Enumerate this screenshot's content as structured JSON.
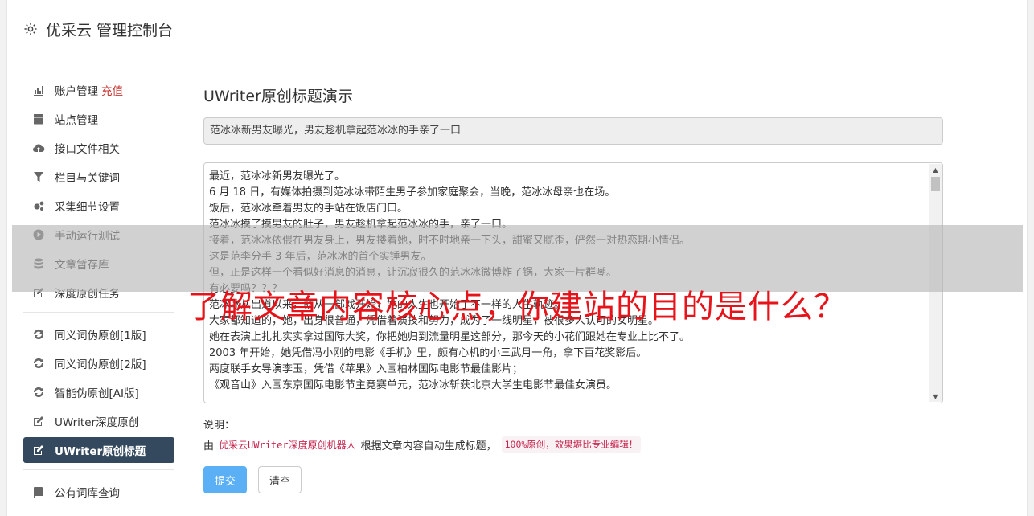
{
  "header": {
    "brand": "优采云 管理控制台"
  },
  "sidebar": {
    "group1": [
      {
        "label": "账户管理",
        "extra": "充值",
        "icon": "bar-chart-icon",
        "name": "sidebar-item-account"
      },
      {
        "label": "站点管理",
        "icon": "server-icon",
        "name": "sidebar-item-sites"
      },
      {
        "label": "接口文件相关",
        "icon": "cloud-upload-icon",
        "name": "sidebar-item-api-files"
      },
      {
        "label": "栏目与关键词",
        "icon": "filter-icon",
        "name": "sidebar-item-columns-keywords"
      },
      {
        "label": "采集细节设置",
        "icon": "gears-icon",
        "name": "sidebar-item-collect-settings"
      },
      {
        "label": "手动运行测试",
        "icon": "play-circle-icon",
        "name": "sidebar-item-manual-run"
      },
      {
        "label": "文章暂存库",
        "icon": "database-icon",
        "name": "sidebar-item-article-store"
      },
      {
        "label": "深度原创任务",
        "icon": "edit-icon",
        "name": "sidebar-item-deep-original"
      }
    ],
    "group2": [
      {
        "label": "同义词伪原创[1版]",
        "icon": "refresh-icon",
        "name": "sidebar-item-synonym-v1"
      },
      {
        "label": "同义词伪原创[2版]",
        "icon": "refresh-icon",
        "name": "sidebar-item-synonym-v2"
      },
      {
        "label": "智能伪原创[AI版]",
        "icon": "refresh-icon",
        "name": "sidebar-item-ai-rewrite"
      },
      {
        "label": "UWriter深度原创",
        "icon": "edit-icon",
        "name": "sidebar-item-uwriter-deep"
      },
      {
        "label": "UWriter原创标题",
        "icon": "edit-icon",
        "name": "sidebar-item-uwriter-title",
        "active": true
      }
    ],
    "group3": [
      {
        "label": "公有词库查询",
        "icon": "book-icon",
        "name": "sidebar-item-public-lexicon"
      }
    ]
  },
  "main": {
    "title": "UWriter原创标题演示",
    "title_value": "范冰冰新男友曝光，男友趁机拿起范冰冰的手亲了一口",
    "content_lines": [
      "最近，范冰冰新男友曝光了。",
      "6 月 18 日，有媒体拍摄到范冰冰带陌生男子参加家庭聚会，当晚，范冰冰母亲也在场。",
      "饭后，范冰冰牵着男友的手站在饭店门口。",
      "范冰冰摸了摸男友的肚子，男友趁机拿起范冰冰的手，亲了一口。",
      "接着，范冰冰依偎在男友身上，男友搂着她，时不时地亲一下头，甜蜜又腻歪，俨然一对热恋期小情侣。",
      "这是范李分手 3 年后，范冰冰的首个实锤男友。",
      "但，正是这样一个看似好消息的消息，让沉寂很久的范冰冰微博炸了锅，大家一片群嘲。",
      "有必要吗？？？",
      "范冰冰从出道以来，就从一部戏开始，她的人生也开始了不一样的人生轨迹。",
      "大家都知道的，她，出身很普通，凭借着演技和努力，成为了一线明星，被很多人认可的女明星。",
      "她在表演上扎扎实实拿过国际大奖，你把她归到流量明星这部分，那今天的小花们跟她在专业上比不了。",
      "2003 年开始，她凭借冯小刚的电影《手机》里，颇有心机的小三武月一角，拿下百花奖影后。",
      "两度联手女导演李玉，凭借《苹果》入围柏林国际电影节最佳影片；",
      "《观音山》入围东京国际电影节主竞赛单元，范冰冰斩获北京大学生电影节最佳女演员。"
    ],
    "note_label": "说明：",
    "note_prefix": "由",
    "note_code": "优采云UWriter深度原创机器人",
    "note_mid": "根据文章内容自动生成标题，",
    "note_badge": "100%原创，效果堪比专业编辑！",
    "submit_label": "提交",
    "clear_label": "清空"
  },
  "overlay": {
    "headline": "了解文章内容核心点，你建站的目的是什么？"
  },
  "colors": {
    "active_nav": "#34495e",
    "primary": "#5bb0f5",
    "accent_red": "#c9302c",
    "headline_red": "#e6141a"
  }
}
